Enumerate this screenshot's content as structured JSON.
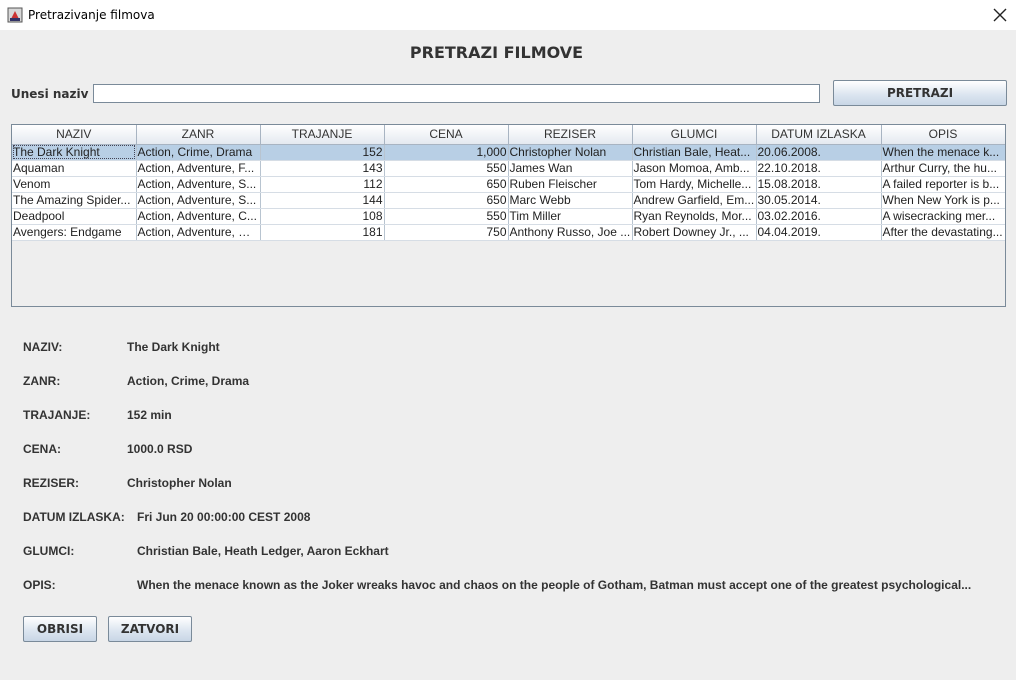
{
  "window": {
    "title": "Pretrazivanje filmova",
    "icon": "java-app-icon",
    "close_icon": "close-icon"
  },
  "heading": "PRETRAZI FILMOVE",
  "search": {
    "label": "Unesi naziv",
    "value": "",
    "placeholder": "",
    "button_label": "PRETRAZI"
  },
  "table": {
    "columns": [
      "NAZIV",
      "ZANR",
      "TRAJANJE",
      "CENA",
      "REZISER",
      "GLUMCI",
      "DATUM IZLASKA",
      "OPIS"
    ],
    "selected_row": 0,
    "rows": [
      [
        "The Dark Knight",
        "Action, Crime, Drama",
        "152",
        "1,000",
        "Christopher Nolan",
        "Christian Bale, Heat...",
        "20.06.2008.",
        "When the menace k..."
      ],
      [
        "Aquaman",
        "Action, Adventure, F...",
        "143",
        "550",
        "James Wan",
        "Jason Momoa, Amb...",
        "22.10.2018.",
        "Arthur Curry, the hu..."
      ],
      [
        "Venom",
        "Action, Adventure, S...",
        "112",
        "650",
        "Ruben Fleischer",
        "Tom Hardy, Michelle...",
        "15.08.2018.",
        "A failed reporter is b..."
      ],
      [
        "The Amazing Spider...",
        "Action, Adventure, S...",
        "144",
        "650",
        "Marc Webb",
        "Andrew Garfield, Em...",
        "30.05.2014.",
        "When New York is p..."
      ],
      [
        "Deadpool",
        "Action, Adventure, C...",
        "108",
        "550",
        "Tim Miller",
        "Ryan Reynolds, Mor...",
        "03.02.2016.",
        "A wisecracking mer..."
      ],
      [
        "Avengers: Endgame",
        "Action, Adventure, Dr...",
        "181",
        "750",
        "Anthony Russo, Joe ...",
        "Robert Downey Jr., ...",
        "04.04.2019.",
        "After the devastating..."
      ]
    ]
  },
  "details": {
    "naziv_label": "NAZIV:",
    "naziv": "The Dark Knight",
    "zanr_label": "ZANR:",
    "zanr": "Action, Crime, Drama",
    "trajanje_label": "TRAJANJE:",
    "trajanje": "152 min",
    "cena_label": "CENA:",
    "cena": "1000.0 RSD",
    "reziser_label": "REZISER:",
    "reziser": "Christopher Nolan",
    "datum_label": "DATUM IZLASKA:",
    "datum": "Fri Jun 20 00:00:00 CEST 2008",
    "glumci_label": "GLUMCI:",
    "glumci": "Christian Bale, Heath Ledger, Aaron Eckhart",
    "opis_label": "OPIS:",
    "opis": "When the menace known as the Joker wreaks havoc and chaos on the people of Gotham, Batman must accept one of the greatest psychological..."
  },
  "buttons": {
    "delete_label": "OBRISI",
    "close_label": "ZATVORI"
  }
}
